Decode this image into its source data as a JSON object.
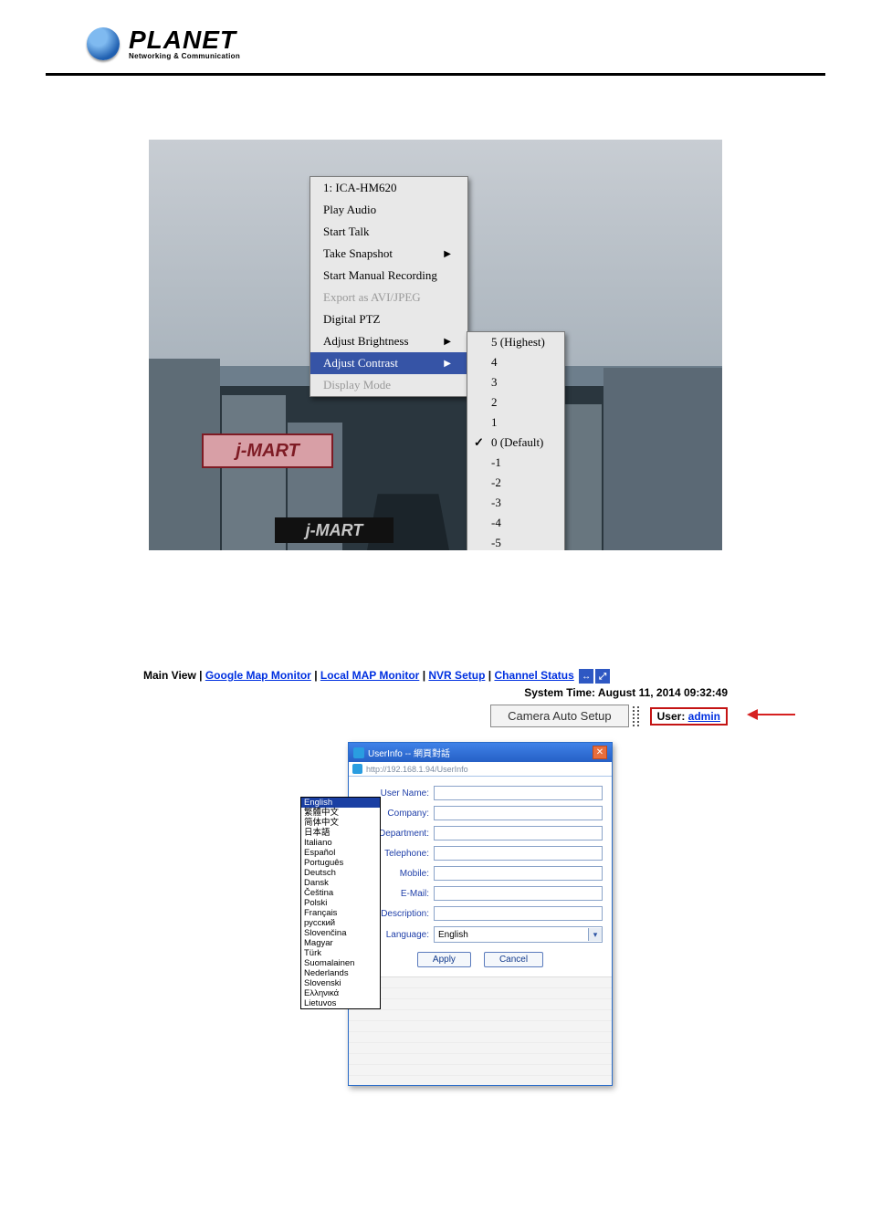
{
  "logo": {
    "brand": "PLANET",
    "tagline": "Networking & Communication"
  },
  "fig1": {
    "sign1": "j-MART",
    "sign2": "j-MART",
    "menu": {
      "camera": "1: ICA-HM620",
      "play_audio": "Play Audio",
      "start_talk": "Start Talk",
      "take_snapshot": "Take Snapshot",
      "start_rec": "Start Manual Recording",
      "export": "Export as AVI/JPEG",
      "digital_ptz": "Digital PTZ",
      "adj_bright": "Adjust Brightness",
      "adj_contrast": "Adjust Contrast",
      "display_mode": "Display Mode"
    },
    "submenu": {
      "p5": "5 (Highest)",
      "p4": "4",
      "p3": "3",
      "p2": "2",
      "p1": "1",
      "p0": "0 (Default)",
      "m1": "-1",
      "m2": "-2",
      "m3": "-3",
      "m4": "-4",
      "m5": "-5"
    }
  },
  "fig2": {
    "nav": {
      "main_view": "Main View",
      "google_map": "Google Map Monitor",
      "local_map": "Local MAP Monitor",
      "nvr_setup": "NVR Setup",
      "channel_status": "Channel Status"
    },
    "system_time_label": "System Time: ",
    "system_time_value": "August 11, 2014 09:32:49",
    "autosetup": "Camera Auto Setup",
    "user_label": "User: ",
    "user_name": "admin",
    "dialog": {
      "title": "UserInfo -- 網頁對話",
      "url": "http://192.168.1.94/UserInfo",
      "fields": {
        "user_name": "User Name:",
        "company": "Company:",
        "department": "Department:",
        "telephone": "Telephone:",
        "mobile": "Mobile:",
        "email": "E-Mail:",
        "description": "Description:",
        "language": "Language:"
      },
      "lang_value": "English",
      "apply": "Apply",
      "cancel": "Cancel"
    },
    "languages": [
      "English",
      "繁體中文",
      "简体中文",
      "日本語",
      "Italiano",
      "Español",
      "Português",
      "Deutsch",
      "Dansk",
      "Čeština",
      "Polski",
      "Français",
      "русский",
      "Slovenčina",
      "Magyar",
      "Türk",
      "Suomalainen",
      "Nederlands",
      "Slovenski",
      "Ελληνικά",
      "Lietuvos"
    ]
  }
}
